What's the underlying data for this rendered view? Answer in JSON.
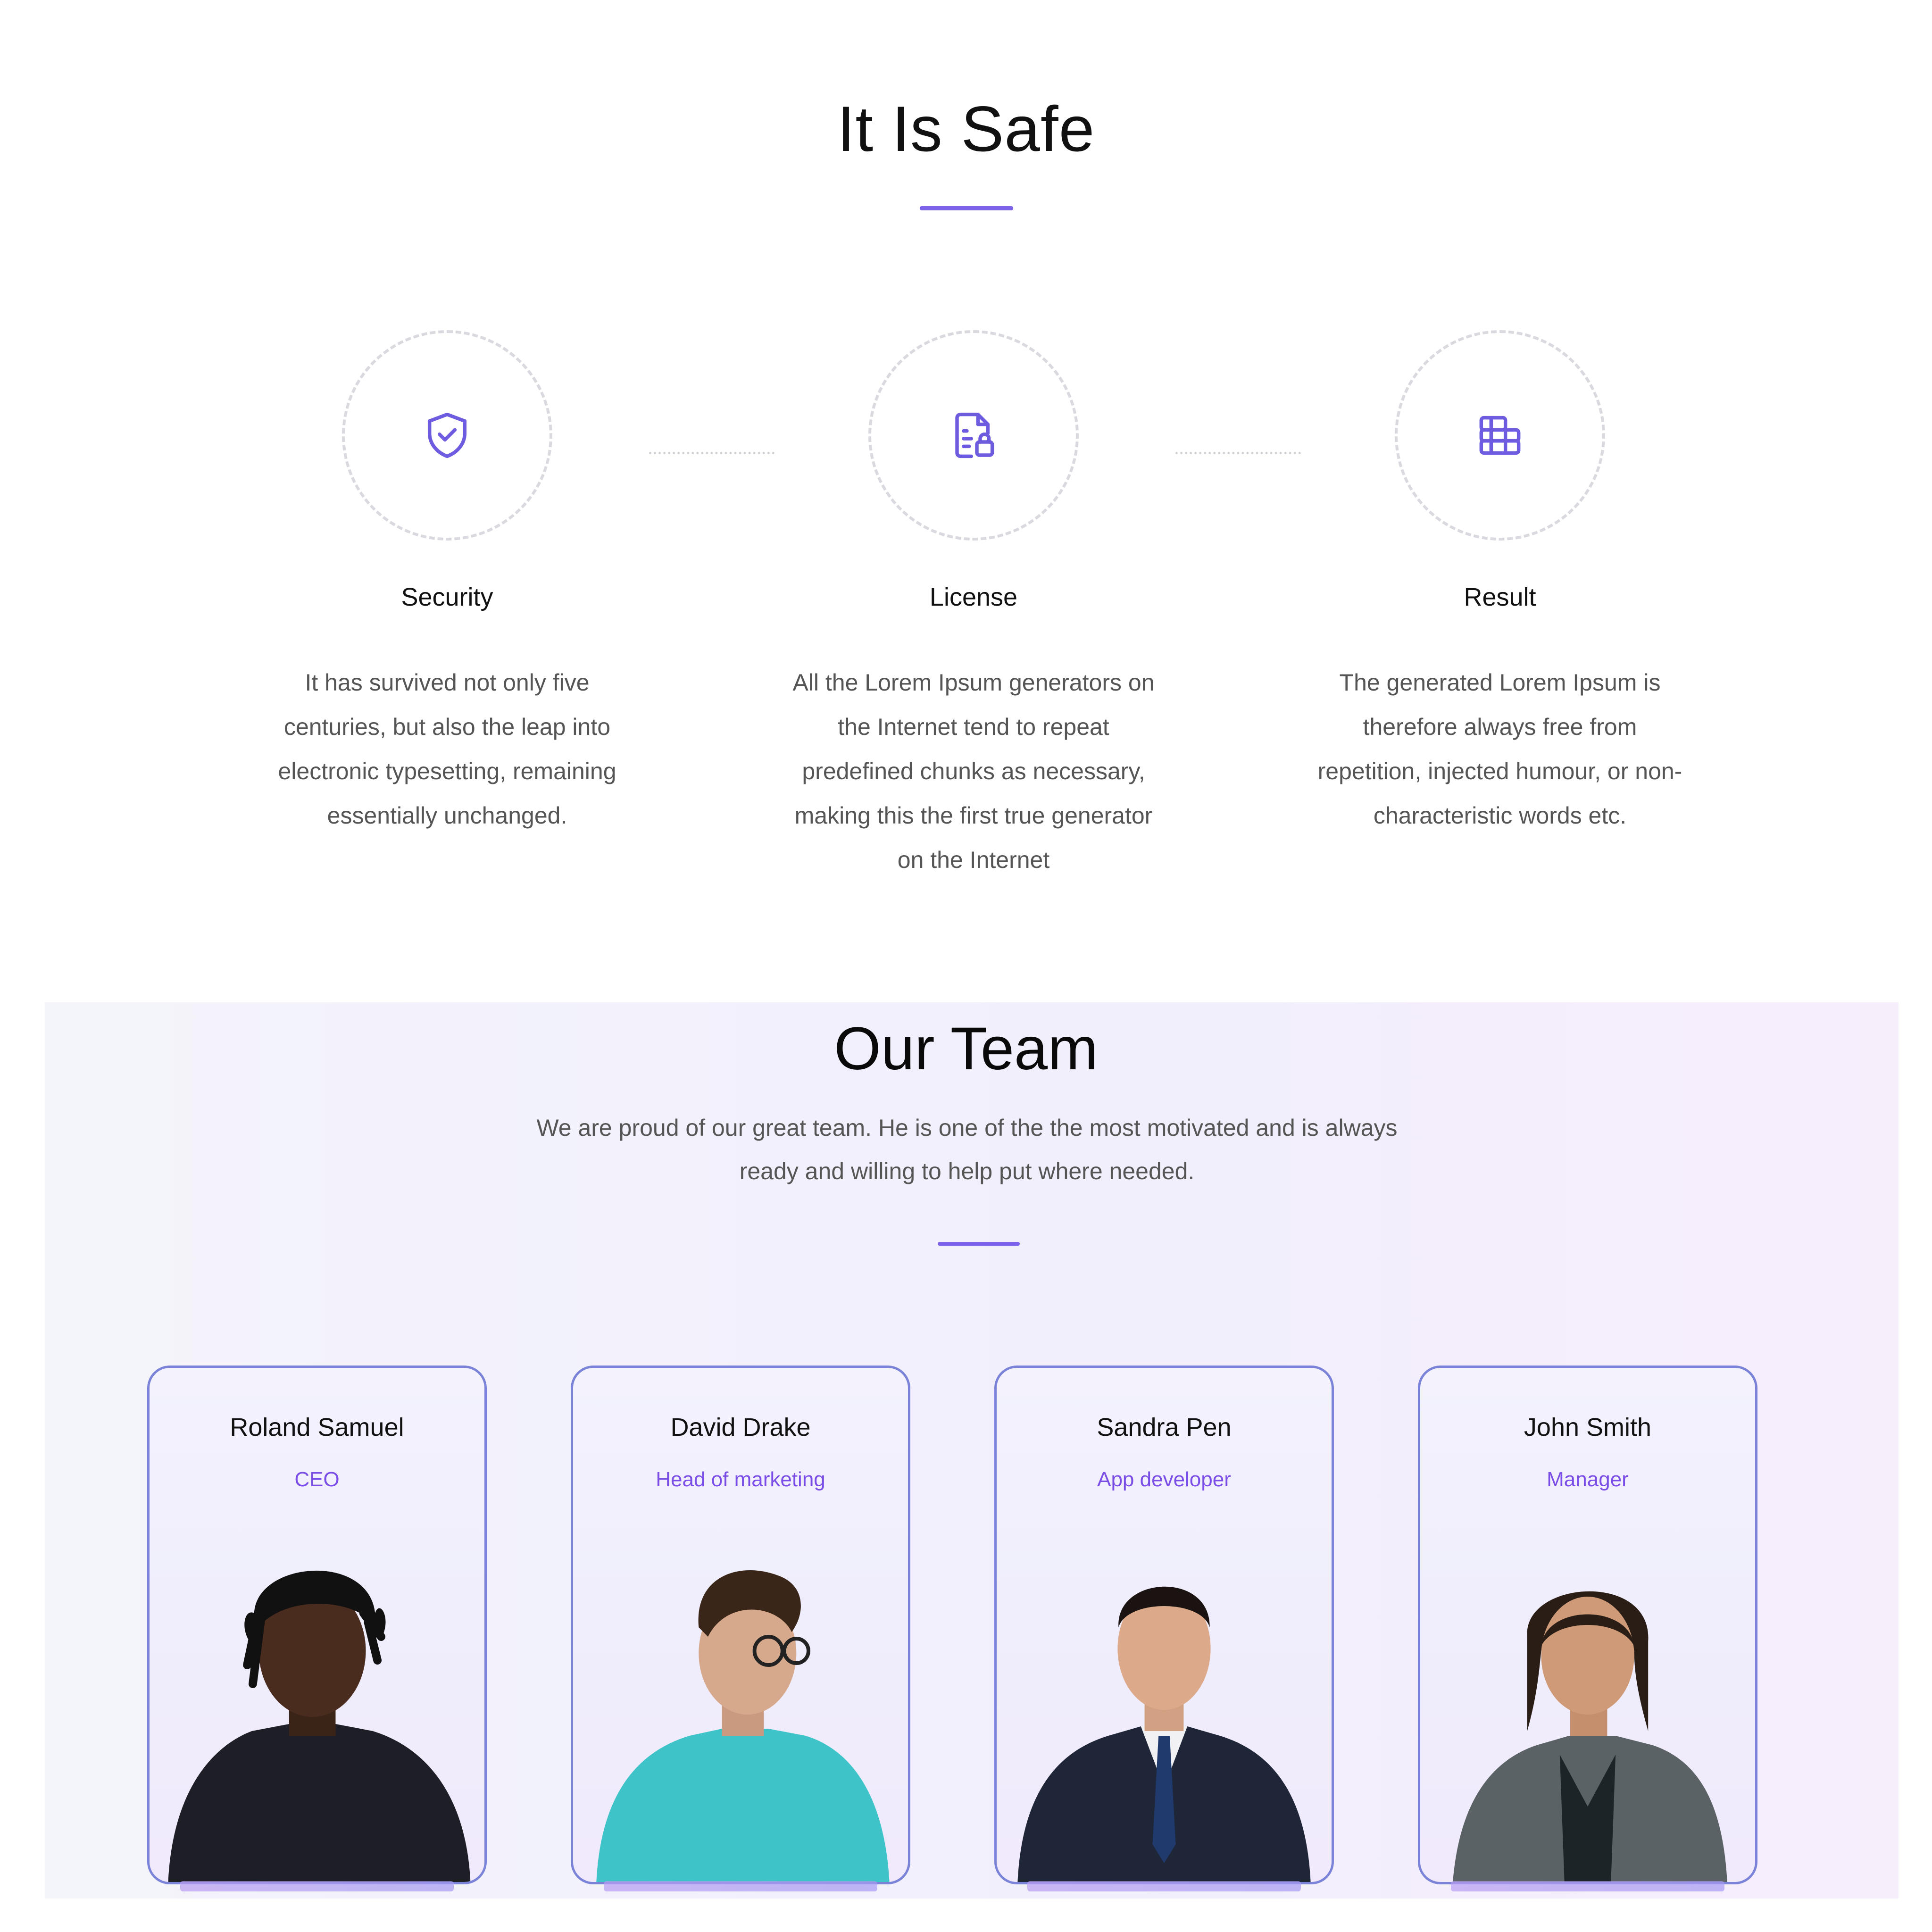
{
  "safe_section": {
    "title": "It Is Safe",
    "features": [
      {
        "title": "Security",
        "icon": "shield-check-icon",
        "text": "It has survived not only five centuries, but also the leap into electronic typesetting, remaining essentially unchanged."
      },
      {
        "title": "License",
        "icon": "document-lock-icon",
        "text": "All the Lorem Ipsum generators on the Internet tend to repeat predefined chunks as necessary, making this the first true generator on the Internet"
      },
      {
        "title": "Result",
        "icon": "database-stack-icon",
        "text": "The generated Lorem Ipsum is therefore always free from repetition, injected humour, or non-characteristic words etc."
      }
    ]
  },
  "team_section": {
    "title": "Our Team",
    "subtitle": "We are proud of our great team. He is one of the the most motivated and is always ready and willing to help put where needed.",
    "members": [
      {
        "name": "Roland Samuel",
        "role": "CEO"
      },
      {
        "name": "David Drake",
        "role": "Head of marketing"
      },
      {
        "name": "Sandra Pen",
        "role": "App developer"
      },
      {
        "name": "John Smith",
        "role": "Manager"
      }
    ]
  },
  "colors": {
    "accent": "#7b62e6",
    "role_text": "#7a4ee6",
    "card_border": "#7a83d8"
  }
}
